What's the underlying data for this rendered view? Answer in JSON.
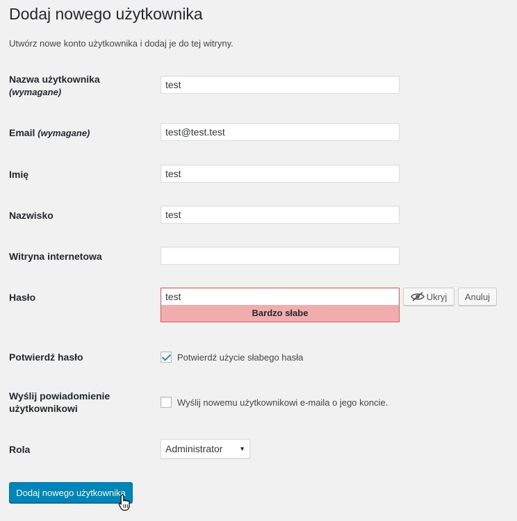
{
  "page": {
    "title": "Dodaj nowego użytkownika",
    "subtitle": "Utwórz nowe konto użytkownika i dodaj je do tej witryny."
  },
  "form": {
    "username": {
      "label": "Nazwa użytkownika",
      "required": "(wymagane)",
      "value": "test"
    },
    "email": {
      "label": "Email",
      "required": "(wymagane)",
      "value": "test@test.test"
    },
    "first_name": {
      "label": "Imię",
      "value": "test"
    },
    "last_name": {
      "label": "Nazwisko",
      "value": "test"
    },
    "website": {
      "label": "Witryna internetowa",
      "value": ""
    },
    "password": {
      "label": "Hasło",
      "value": "test",
      "strength": "Bardzo słabe",
      "hide_label": "Ukryj",
      "cancel_label": "Anuluj"
    },
    "confirm_password": {
      "label": "Potwierdź hasło",
      "checkbox_label": "Potwierdź użycie słabego hasła",
      "checked": true
    },
    "notify": {
      "label_line1": "Wyślij powiadomienie",
      "label_line2": "użytkownikowi",
      "checkbox_label": "Wyślij nowemu użytkownikowi e-maila o jego koncie.",
      "checked": false
    },
    "role": {
      "label": "Rola",
      "value": "Administrator"
    },
    "submit_label": "Dodaj nowego użytkownika"
  },
  "colors": {
    "primary": "#0085ba",
    "weak_bg": "#f1adad",
    "weak_border": "#e35b5b",
    "check": "#1e8cbe"
  }
}
